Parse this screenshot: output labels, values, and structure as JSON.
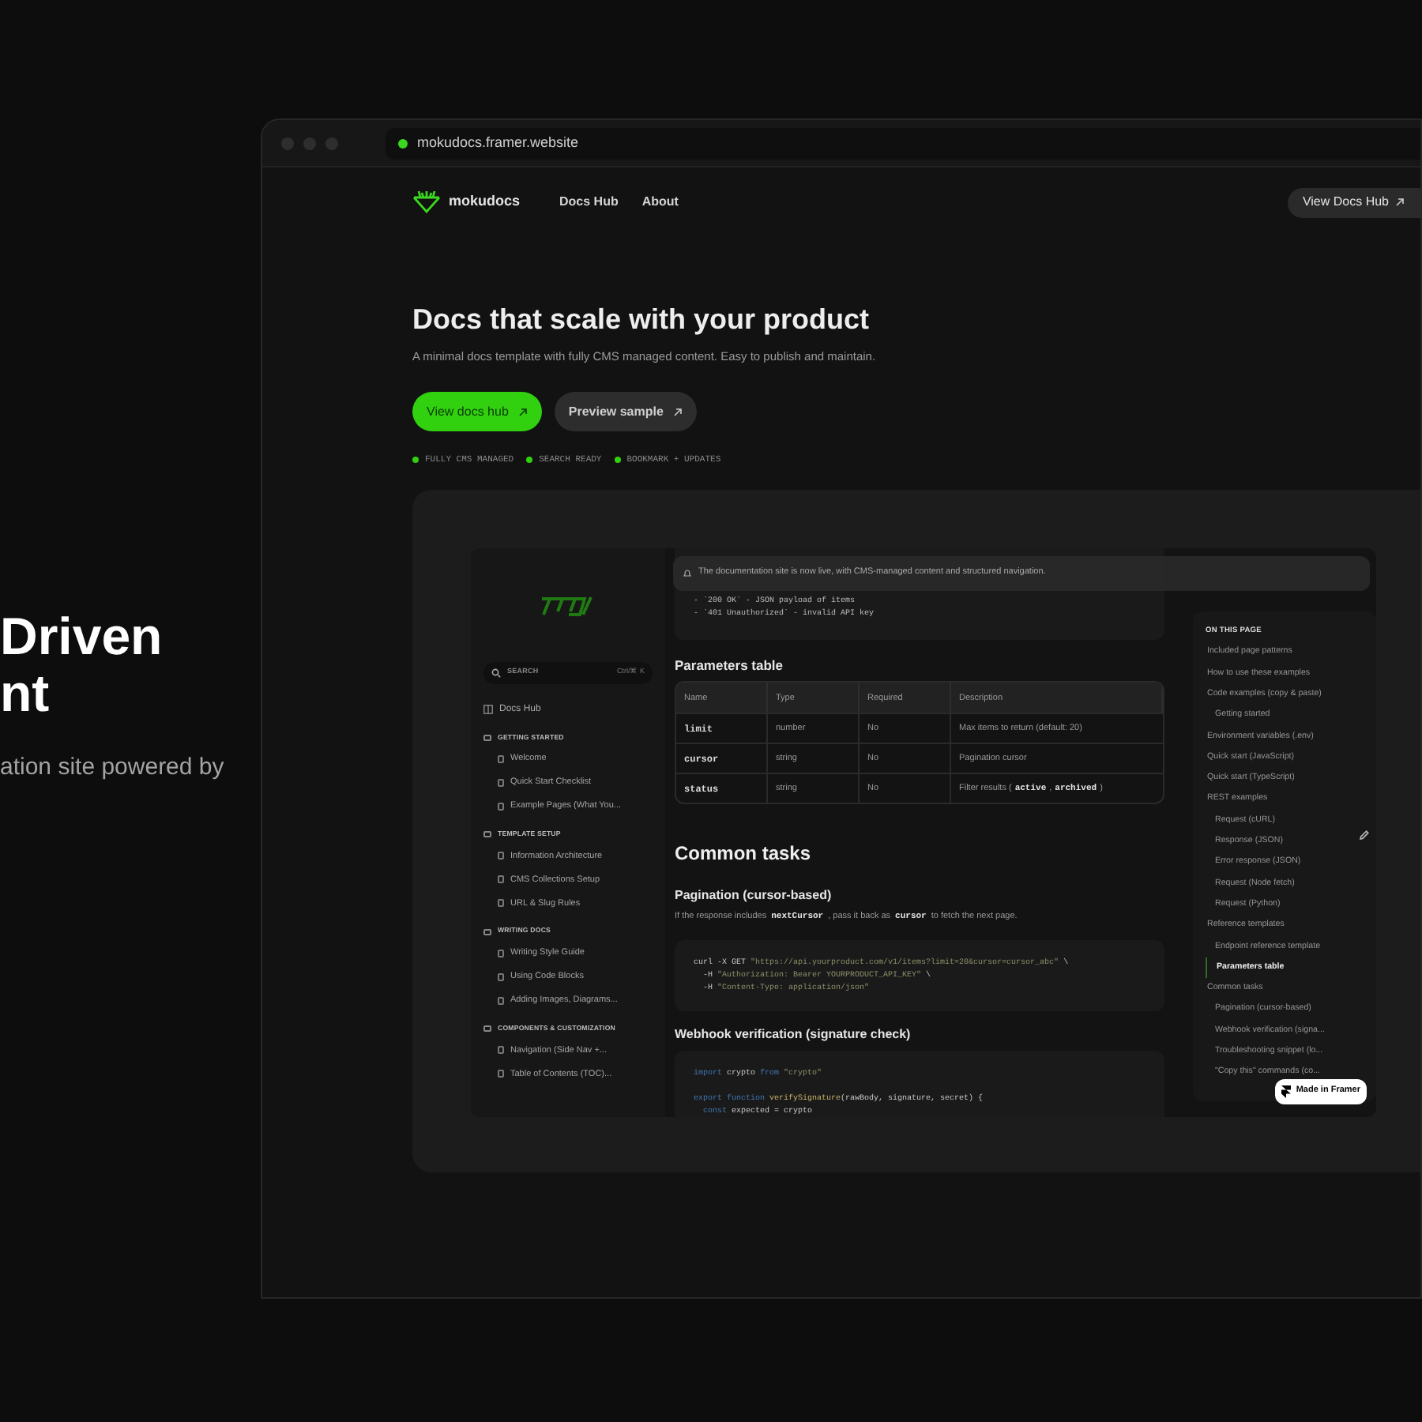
{
  "left_hero": {
    "title_lines": [
      "Driven",
      "nt"
    ],
    "subtitle": "ation site powered by"
  },
  "browser": {
    "url": "mokudocs.framer.website"
  },
  "site_nav": {
    "brand": "mokudocs",
    "links": [
      "Docs Hub",
      "About"
    ],
    "cta": "View Docs Hub"
  },
  "hero": {
    "title": "Docs that scale with your product",
    "subtitle": "A minimal docs template with fully CMS managed content. Easy to publish and maintain.",
    "buttons": [
      {
        "label": "View docs hub",
        "kind": "primary"
      },
      {
        "label": "Preview sample",
        "kind": "secondary"
      }
    ],
    "features": [
      "FULLY CMS MANAGED",
      "SEARCH READY",
      "BOOKMARK + UPDATES"
    ]
  },
  "preview": {
    "sidebar": {
      "search_placeholder": "SEARCH",
      "shortcut": "Ctrl/⌘ K",
      "home": "Docs Hub",
      "sections": [
        {
          "title": "GETTING STARTED",
          "items": [
            "Welcome",
            "Quick Start Checklist",
            "Example Pages (What You..."
          ]
        },
        {
          "title": "TEMPLATE SETUP",
          "items": [
            "Information Architecture",
            "CMS Collections Setup",
            "URL & Slug Rules"
          ]
        },
        {
          "title": "WRITING DOCS",
          "items": [
            "Writing Style Guide",
            "Using Code Blocks",
            "Adding Images, Diagrams..."
          ]
        },
        {
          "title": "COMPONENTS & CUSTOMIZATION",
          "items": [
            "Navigation (Side Nav +...",
            "Table of Contents (TOC)..."
          ]
        }
      ]
    },
    "banner": "The documentation site is now live, with CMS-managed content and structured navigation.",
    "response_lines": [
      "- `200 OK` - JSON payload of items",
      "- `401 Unauthorized` - invalid API key"
    ],
    "params_title": "Parameters table",
    "table": {
      "columns": [
        "Name",
        "Type",
        "Required",
        "Description"
      ],
      "rows": [
        {
          "name": "limit",
          "type": "number",
          "required": "No",
          "description": [
            {
              "text": "Max items to return (default: 20)",
              "code": false
            }
          ]
        },
        {
          "name": "cursor",
          "type": "string",
          "required": "No",
          "description": [
            {
              "text": "Pagination cursor",
              "code": false
            }
          ]
        },
        {
          "name": "status",
          "type": "string",
          "required": "No",
          "description": [
            {
              "text": "Filter results (",
              "code": false
            },
            {
              "text": "active",
              "code": true
            },
            {
              "text": ",",
              "code": false
            },
            {
              "text": "archived",
              "code": true
            },
            {
              "text": ")",
              "code": false
            }
          ]
        }
      ]
    },
    "common_title": "Common tasks",
    "pagination_title": "Pagination (cursor-based)",
    "pagination_text": [
      {
        "text": "If the response includes",
        "code": false
      },
      {
        "text": "nextCursor",
        "code": true
      },
      {
        "text": ", pass it back as",
        "code": false
      },
      {
        "text": "cursor",
        "code": true
      },
      {
        "text": "to fetch the next page.",
        "code": false
      }
    ],
    "curl_code": [
      [
        {
          "kind": "plain",
          "text": "curl -X GET "
        },
        {
          "kind": "string",
          "text": "\"https://api.yourproduct.com/v1/items?limit=20&cursor=cursor_abc\""
        },
        {
          "kind": "plain",
          "text": " \\"
        }
      ],
      [
        {
          "kind": "plain",
          "text": "  -H "
        },
        {
          "kind": "string",
          "text": "\"Authorization: Bearer YOURPRODUCT_API_KEY\""
        },
        {
          "kind": "plain",
          "text": " \\"
        }
      ],
      [
        {
          "kind": "plain",
          "text": "  -H "
        },
        {
          "kind": "string",
          "text": "\"Content-Type: application/json\""
        }
      ]
    ],
    "webhook_title": "Webhook verification (signature check)",
    "webhook_code": [
      [
        [
          {
            "kind": "keyword",
            "text": "import"
          },
          {
            "kind": "plain",
            "text": " crypto "
          },
          {
            "kind": "keyword",
            "text": "from"
          },
          {
            "kind": "string",
            "text": " \"crypto\""
          }
        ]
      ],
      [
        [
          {
            "kind": "keyword",
            "text": "export function"
          },
          {
            "kind": "function",
            "text": " verifySignature"
          },
          {
            "kind": "plain",
            "text": "(rawBody, signature, secret) {"
          }
        ],
        [
          {
            "kind": "keyword",
            "text": "  const"
          },
          {
            "kind": "plain",
            "text": " expected = crypto"
          }
        ]
      ]
    ],
    "toc": {
      "title": "ON THIS PAGE",
      "items": [
        {
          "label": "Included page patterns",
          "selected": false
        },
        {
          "label": "How to use these examples",
          "selected": false
        },
        {
          "label": "Code examples (copy & paste)",
          "selected": false,
          "children": [
            {
              "label": "Getting started",
              "selected": false
            }
          ]
        },
        {
          "label": "Environment variables (.env)",
          "selected": false
        },
        {
          "label": "Quick start (JavaScript)",
          "selected": false
        },
        {
          "label": "Quick start (TypeScript)",
          "selected": false
        },
        {
          "label": "REST examples",
          "selected": false,
          "children": [
            {
              "label": "Request (cURL)",
              "selected": false
            },
            {
              "label": "Response (JSON)",
              "selected": false
            },
            {
              "label": "Error response (JSON)",
              "selected": false
            },
            {
              "label": "Request (Node fetch)",
              "selected": false
            },
            {
              "label": "Request (Python)",
              "selected": false
            }
          ]
        },
        {
          "label": "Reference templates",
          "selected": false,
          "children": [
            {
              "label": "Endpoint reference template",
              "selected": false
            },
            {
              "label": "Parameters table",
              "selected": true
            }
          ]
        },
        {
          "label": "Common tasks",
          "selected": false,
          "children": [
            {
              "label": "Pagination (cursor-based)",
              "selected": false
            },
            {
              "label": "Webhook verification (signa...",
              "selected": false
            },
            {
              "label": "Troubleshooting snippet (lo...",
              "selected": false
            },
            {
              "label": "\"Copy this\" commands (co...",
              "selected": false
            }
          ]
        }
      ]
    },
    "badge": "Made in Framer"
  }
}
